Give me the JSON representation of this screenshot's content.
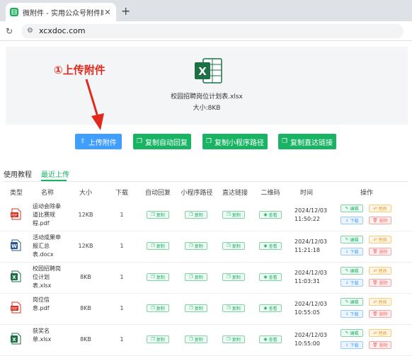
{
  "browser": {
    "tab_title": "微附件 - 实用公众号附件助手, 在线...",
    "close_symbol": "✕",
    "new_tab_symbol": "+",
    "reload_symbol": "↻",
    "url": "xcxdoc.com"
  },
  "upload_panel": {
    "file_name": "校园招聘岗位计划表.xlsx",
    "size_label": "大小:",
    "size_value": "8KB",
    "annotation": "①上传附件"
  },
  "buttons": [
    {
      "label": "上传附件",
      "icon": "upload-icon"
    },
    {
      "label": "复制自动回复",
      "icon": "copy-icon"
    },
    {
      "label": "复制小程序路径",
      "icon": "copy-icon"
    },
    {
      "label": "复制直达链接",
      "icon": "copy-icon"
    }
  ],
  "tabs": {
    "tutorial": "使用教程",
    "recent": "最近上传"
  },
  "table": {
    "headers": [
      "类型",
      "名称",
      "大小",
      "下载",
      "自动回复",
      "小程序路径",
      "直达链接",
      "二维码",
      "时间",
      "操作"
    ],
    "copy_label": "复制",
    "view_label": "查看",
    "edit_label": "编辑",
    "replace_label": "替换",
    "download_label": "下载",
    "delete_label": "删除",
    "rows": [
      {
        "type": "pdf",
        "name": "运动会除拳道比赛规程.pdf",
        "size": "12KB",
        "downloads": "1",
        "time": "2024/12/03 11:50:22"
      },
      {
        "type": "doc",
        "name": "活动成果申报汇总表.docx",
        "size": "12KB",
        "downloads": "1",
        "time": "2024/12/03 11:21:18"
      },
      {
        "type": "xls",
        "name": "校园招聘岗位计划表.xlsx",
        "size": "8KB",
        "downloads": "1",
        "time": "2024/12/03 11:03:31"
      },
      {
        "type": "pdf",
        "name": "岗位信息.pdf",
        "size": "8KB",
        "downloads": "1",
        "time": "2024/12/03 10:55:05"
      },
      {
        "type": "xls",
        "name": "获奖名单.xlsx",
        "size": "8KB",
        "downloads": "1",
        "time": "2024/12/03 10:55:00"
      }
    ]
  },
  "colors": {
    "primary_blue": "#409eff",
    "primary_green": "#19b364",
    "annotation_red": "#e0291c"
  }
}
